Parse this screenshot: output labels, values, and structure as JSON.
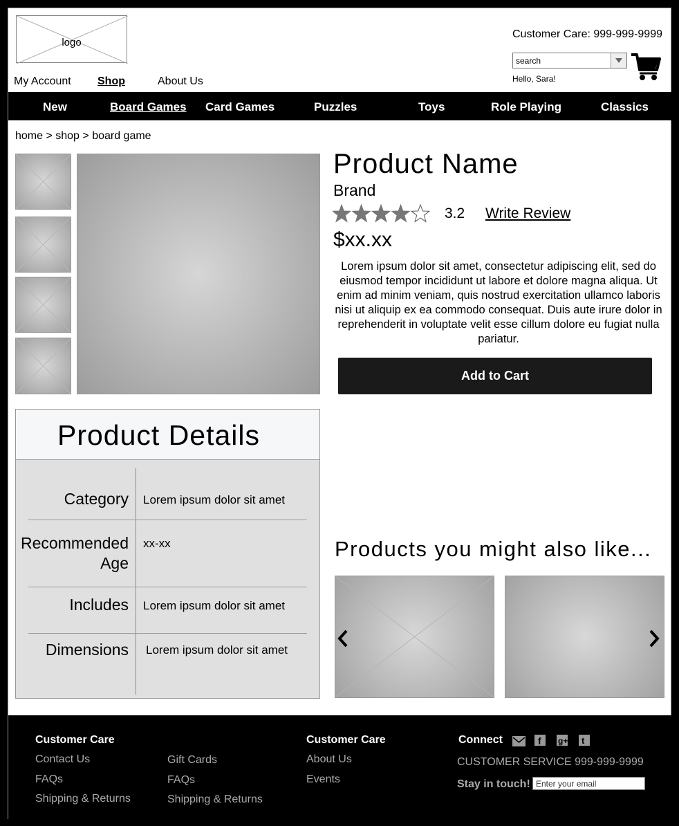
{
  "header": {
    "logo_label": "logo",
    "customer_care": "Customer Care: 999-999-9999",
    "search_value": "search",
    "greeting": "Hello, Sara!"
  },
  "top_nav": [
    {
      "label": "My Account",
      "active": false
    },
    {
      "label": "Shop",
      "active": true
    },
    {
      "label": "About Us",
      "active": false
    }
  ],
  "categories": [
    {
      "label": "New",
      "active": false
    },
    {
      "label": "Board Games",
      "active": true
    },
    {
      "label": "Card Games",
      "active": false
    },
    {
      "label": "Puzzles",
      "active": false
    },
    {
      "label": "Toys",
      "active": false
    },
    {
      "label": "Role Playing",
      "active": false
    },
    {
      "label": "Classics",
      "active": false
    }
  ],
  "breadcrumb": "home > shop > board game",
  "product": {
    "name": "Product Name",
    "brand": "Brand",
    "rating": "3.2",
    "rating_value": 3.2,
    "rating_max": 5,
    "write_review": "Write Review",
    "price": "$xx.xx",
    "description": "Lorem ipsum dolor sit amet, consectetur adipiscing elit, sed do eiusmod tempor incididunt ut labore et dolore magna aliqua. Ut enim ad minim veniam, quis nostrud exercitation ullamco laboris nisi ut aliquip ex ea commodo consequat. Duis aute irure dolor in reprehenderit in voluptate velit esse cillum dolore eu fugiat nulla pariatur.",
    "add_to_cart": "Add to Cart"
  },
  "details": {
    "title": "Product Details",
    "rows": [
      {
        "label": "Category",
        "value": "Lorem ipsum dolor sit amet"
      },
      {
        "label": "Recommended Age",
        "value": "xx-xx"
      },
      {
        "label": "Includes",
        "value": "Lorem ipsum dolor sit amet"
      },
      {
        "label": "Dimensions",
        "value": "Lorem ipsum dolor sit amet"
      }
    ]
  },
  "also_like": {
    "title": "Products you might also like..."
  },
  "footer": {
    "col1_title": "Customer Care",
    "col1_links": [
      "Contact Us",
      "FAQs",
      "Shipping & Returns"
    ],
    "col2_links": [
      "Gift Cards",
      "FAQs",
      "Shipping & Returns"
    ],
    "col3_title": "Customer Care",
    "col3_links": [
      "About Us",
      "Events"
    ],
    "connect_title": "Connect",
    "service": "CUSTOMER SERVICE 999-999-9999",
    "stay": "Stay in touch!",
    "email_placeholder": "Enter your email"
  },
  "colors": {
    "accent": "#000000",
    "button": "#1a1a1a",
    "footer_text": "#aaaaaa"
  }
}
